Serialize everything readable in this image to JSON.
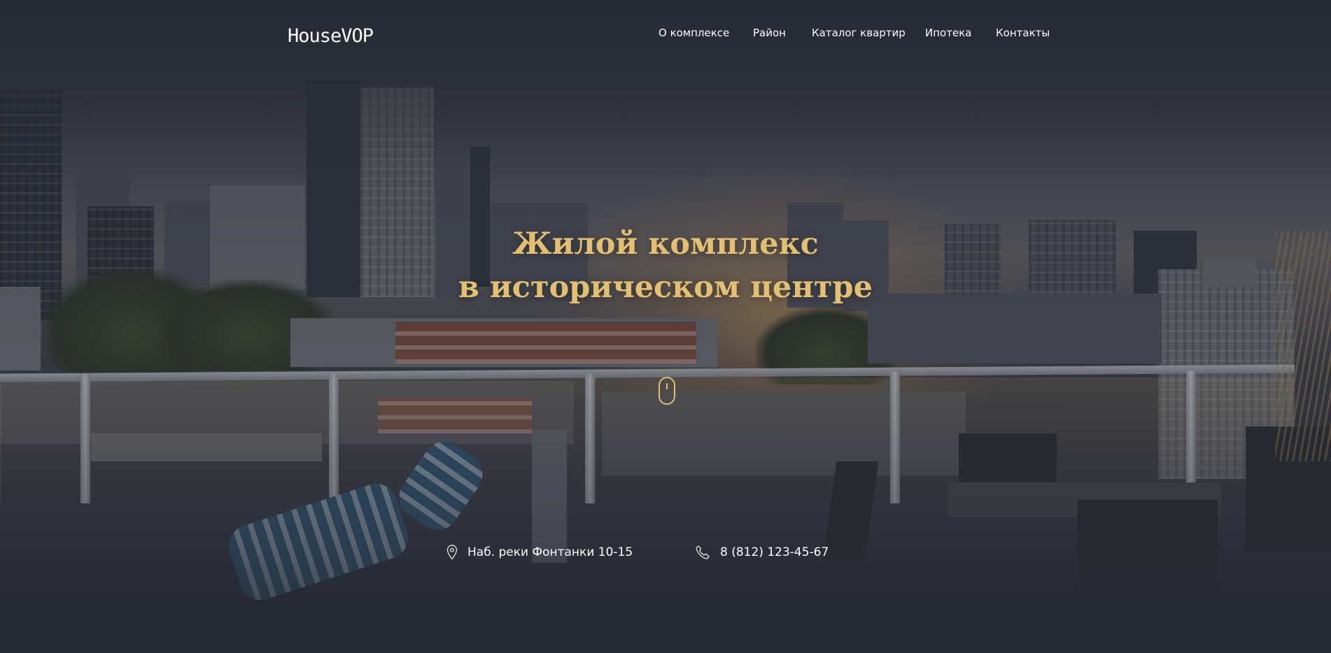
{
  "header": {
    "logo": "HouseVOP",
    "nav": [
      {
        "label": "О комплексе"
      },
      {
        "label": "Район"
      },
      {
        "label": "Каталог квартир"
      },
      {
        "label": "Ипотека"
      },
      {
        "label": "Контакты"
      }
    ]
  },
  "hero": {
    "title_line1": "Жилой комплекс",
    "title_line2": "в историческом центре",
    "scroll_icon": "mouse-scroll-icon",
    "background": "city-rooftop-terrace-at-dusk-photo"
  },
  "contacts": {
    "address": {
      "icon": "map-pin-icon",
      "text": "Наб. реки Фонтанки 10-15"
    },
    "phone": {
      "icon": "phone-icon",
      "text": "8 (812) 123-45-67"
    }
  },
  "colors": {
    "accent": "#e2bf72",
    "background": "#262a33",
    "text": "#ffffff"
  }
}
